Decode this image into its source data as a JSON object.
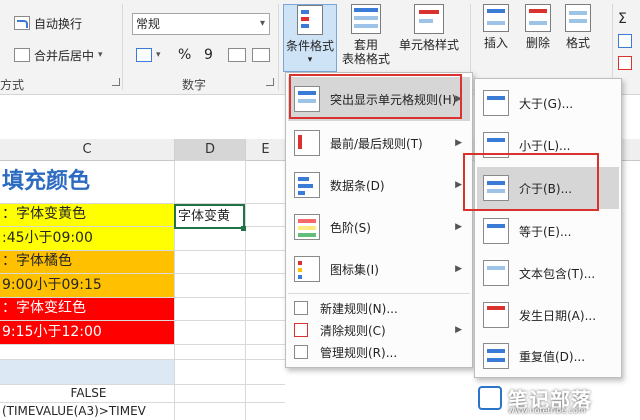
{
  "ribbon": {
    "wrap_text": "自动换行",
    "merge_center": "合并后居中",
    "alignment_group": "方式",
    "number_format_value": "常规",
    "number_group": "数字",
    "percent_symbol": "%",
    "comma_symbol": "9",
    "conditional_format": "条件格式",
    "format_as_table": "套用\n表格格式",
    "cell_styles": "单元格样式",
    "insert": "插入",
    "delete": "删除",
    "format": "格式"
  },
  "columns": [
    "C",
    "D",
    "E"
  ],
  "grid": {
    "rows": [
      "填充颜色",
      "：字体变黄色",
      ":45小于09:00",
      "：字体橘色",
      "9:00小于09:15",
      "：字体变红色",
      "9:15小于12:00",
      "",
      "",
      "FALSE",
      "(TIMEVALUE(A3)>TIMEV"
    ],
    "row_colors": [
      "#ffffff",
      "#ffff00",
      "#ffff00",
      "#ffc000",
      "#ffc000",
      "#ff0000",
      "#ff0000",
      "#ffffff",
      "#dde8f5",
      "#ffffff",
      "#ffffff"
    ],
    "active_cell_text": "字体变黄"
  },
  "cf_menu": {
    "items": [
      "突出显示单元格规则(H)",
      "最前/最后规则(T)",
      "数据条(D)",
      "色阶(S)",
      "图标集(I)"
    ],
    "small_items": [
      "新建规则(N)...",
      "清除规则(C)",
      "管理规则(R)..."
    ]
  },
  "highlight_menu": {
    "items": [
      "大于(G)...",
      "小于(L)...",
      "介于(B)...",
      "等于(E)...",
      "文本包含(T)...",
      "发生日期(A)...",
      "重复值(D)..."
    ]
  },
  "watermark": {
    "text": "笔记部落",
    "url": "www.notetribe.com"
  },
  "colors": {
    "accent_red": "#d9322f",
    "selection_green": "#217346",
    "highlight_blue": "#cfe3f7"
  }
}
